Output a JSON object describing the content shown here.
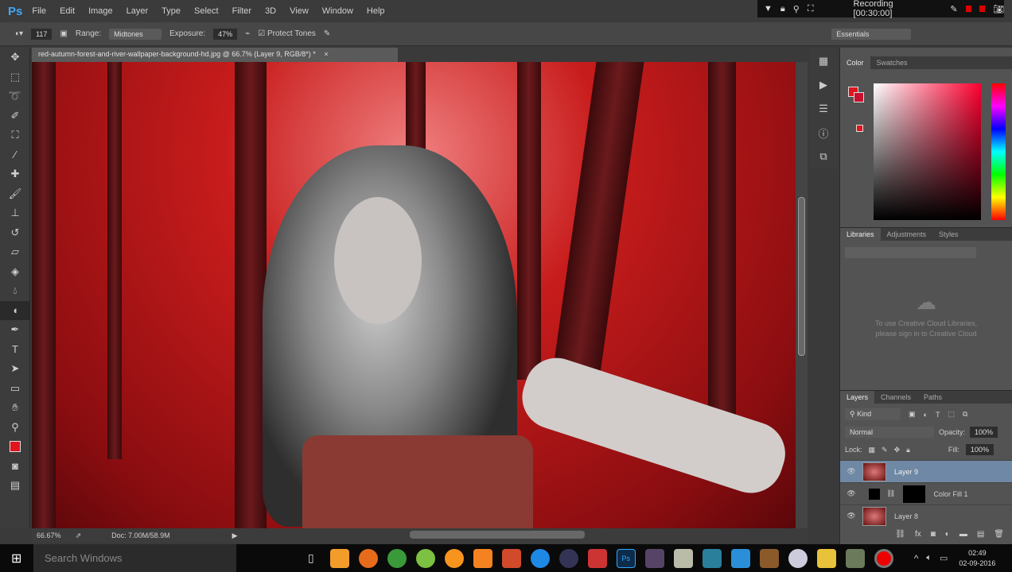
{
  "menubar": {
    "logo": "Ps",
    "items": [
      "File",
      "Edit",
      "Image",
      "Layer",
      "Type",
      "Select",
      "Filter",
      "3D",
      "View",
      "Window",
      "Help"
    ]
  },
  "recorder": {
    "label": "Recording [00:30:00]"
  },
  "options": {
    "brush_size": "117",
    "range_label": "Range:",
    "range_value": "Midtones",
    "exposure_label": "Exposure:",
    "exposure_value": "47%",
    "protect_tones": "Protect Tones",
    "workspace": "Essentials"
  },
  "document": {
    "tab": "red-autumn-forest-and-river-wallpaper-background-hd.jpg @ 66.7% (Layer 9, RGB/8*) *",
    "close": "×"
  },
  "status": {
    "zoom": "66.67%",
    "doc": "Doc: 7.00M/58.9M"
  },
  "color_panel": {
    "tabs": [
      "Color",
      "Swatches"
    ],
    "foreground": "#e0141e",
    "background": "#c8102e"
  },
  "libraries_panel": {
    "tabs": [
      "Libraries",
      "Adjustments",
      "Styles"
    ],
    "message_1": "To use Creative Cloud Libraries,",
    "message_2": "please sign in to Creative Cloud"
  },
  "layers_panel": {
    "tabs": [
      "Layers",
      "Channels",
      "Paths"
    ],
    "filter": "Kind",
    "blend_mode": "Normal",
    "opacity_label": "Opacity:",
    "opacity": "100%",
    "lock_label": "Lock:",
    "fill_label": "Fill:",
    "fill": "100%",
    "layers": [
      {
        "name": "Layer 9",
        "selected": true
      },
      {
        "name": "Color Fill 1",
        "selected": false
      },
      {
        "name": "Layer 8",
        "selected": false
      }
    ]
  },
  "taskbar": {
    "search_placeholder": "Search Windows",
    "time": "02:49",
    "date": "02-09-2016"
  }
}
